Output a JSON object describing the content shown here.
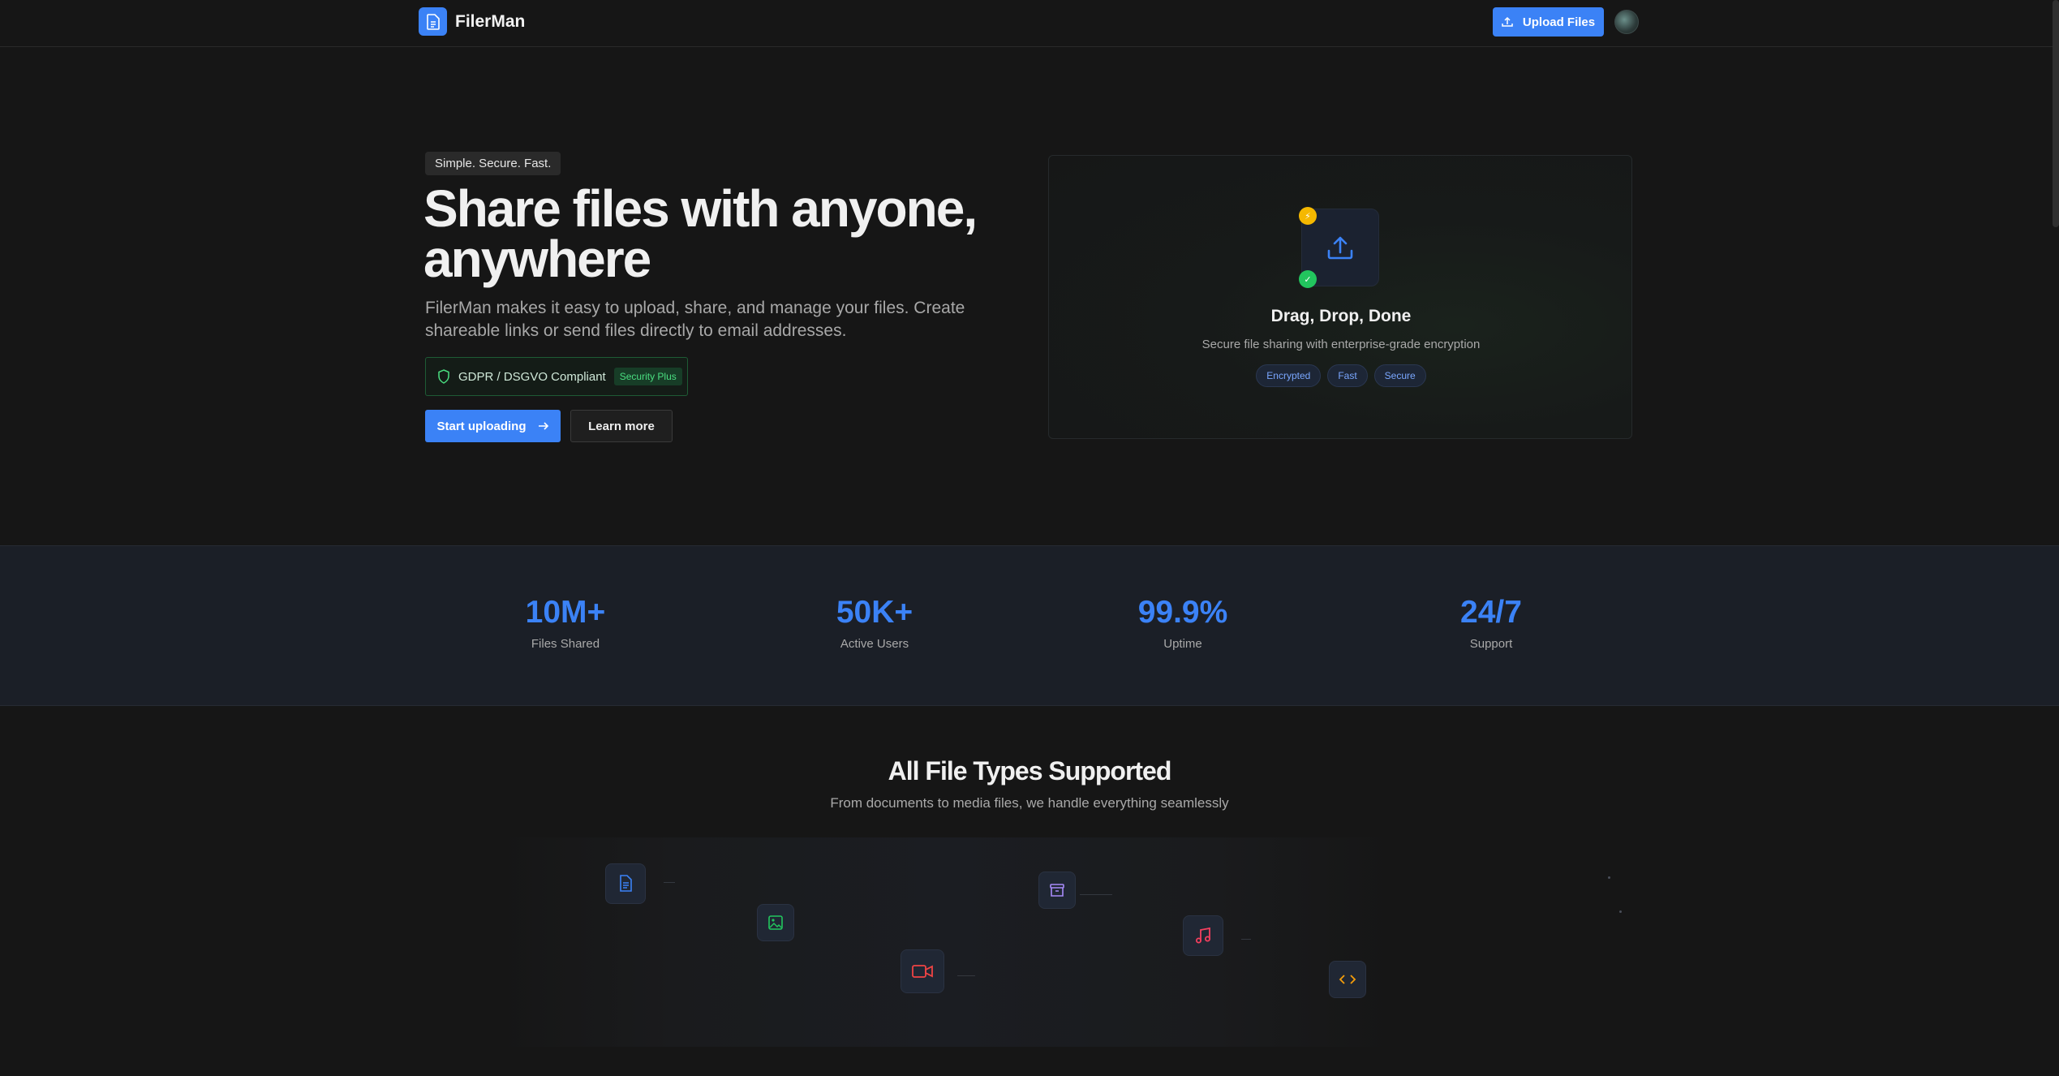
{
  "nav": {
    "brand": "FilerMan",
    "upload_label": "Upload Files"
  },
  "hero": {
    "tagline": "Simple. Secure. Fast.",
    "title": "Share files with anyone, anywhere",
    "description": "FilerMan makes it easy to upload, share, and manage your files. Create shareable links or send files directly to email addresses.",
    "compliance_label": "GDPR / DSGVO Compliant",
    "compliance_badge": "Security Plus",
    "primary_cta": "Start uploading",
    "secondary_cta": "Learn more"
  },
  "dropzone": {
    "title": "Drag, Drop, Done",
    "subtitle": "Secure file sharing with enterprise-grade encryption",
    "tags": [
      "Encrypted",
      "Fast",
      "Secure"
    ]
  },
  "stats": [
    {
      "value": "10M+",
      "label": "Files Shared"
    },
    {
      "value": "50K+",
      "label": "Active Users"
    },
    {
      "value": "99.9%",
      "label": "Uptime"
    },
    {
      "value": "24/7",
      "label": "Support"
    }
  ],
  "file_types": {
    "title": "All File Types Supported",
    "subtitle": "From documents to media files, we handle everything seamlessly",
    "icons": [
      "document-icon",
      "image-icon",
      "video-icon",
      "archive-icon",
      "music-icon",
      "code-icon"
    ]
  },
  "colors": {
    "accent": "#3b82f6",
    "background": "#161616",
    "success": "#22c55e",
    "warning": "#f5b800"
  }
}
